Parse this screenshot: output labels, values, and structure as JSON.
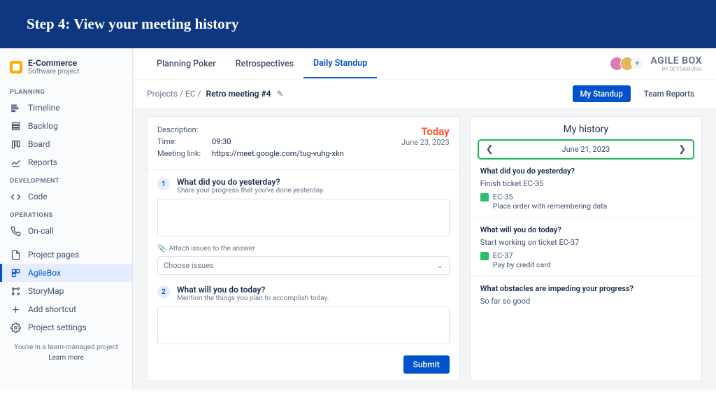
{
  "banner": "Step 4: View your meeting history",
  "project": {
    "name": "E-Commerce",
    "subtitle": "Software project"
  },
  "sections": {
    "planning": "PLANNING",
    "development": "DEVELOPMENT",
    "operations": "OPERATIONS"
  },
  "nav": {
    "timeline": "Timeline",
    "backlog": "Backlog",
    "board": "Board",
    "reports": "Reports",
    "code": "Code",
    "oncall": "On-call",
    "pages": "Project pages",
    "agilebox": "AgileBox",
    "storymap": "StoryMap",
    "shortcut": "Add shortcut",
    "settings": "Project settings"
  },
  "footer": {
    "line": "You're in a team-managed project",
    "learn": "Learn more"
  },
  "tabs": {
    "poker": "Planning Poker",
    "retro": "Retrospectives",
    "standup": "Daily Standup"
  },
  "brand": {
    "title": "AGILE BOX",
    "sub": "BY DEVSAMURAI"
  },
  "breadcrumb": {
    "projects": "Projects",
    "ec": "EC",
    "title": "Retro meeting #4"
  },
  "actions": {
    "my": "My Standup",
    "team": "Team Reports"
  },
  "meta": {
    "desc_lbl": "Description:",
    "time_lbl": "Time:",
    "time": "09:30",
    "link_lbl": "Meeting link:",
    "link": "https://meet.google.com/tug-vuhg-xkn",
    "today": "Today",
    "date": "June 23, 2023"
  },
  "q1": {
    "title": "What did you do yesterday?",
    "sub": "Share your progress that you've done yesterday."
  },
  "q2": {
    "title": "What will you do today?",
    "sub": "Mention the things you plan to accomplish today."
  },
  "attach": "Attach issues to the answer",
  "choose": "Choose issues",
  "submit": "Submit",
  "history": {
    "title": "My history",
    "date": "June 21, 2023",
    "q1": "What did you do yesterday?",
    "a1": "Finish ticket EC-35",
    "t1_id": "EC-35",
    "t1_desc": "Place order with remembering data",
    "q2": "What will you do today?",
    "a2": "Start working on ticket EC-37",
    "t2_id": "EC-37",
    "t2_desc": "Pay by credit card",
    "q3": "What obstacles are impeding your progress?",
    "a3": "So far so good"
  }
}
